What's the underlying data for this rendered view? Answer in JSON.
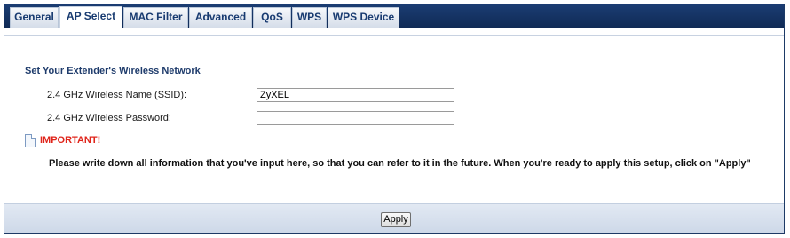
{
  "tabs": [
    {
      "label": "General",
      "active": false
    },
    {
      "label": "AP Select",
      "active": true
    },
    {
      "label": "MAC Filter",
      "active": false
    },
    {
      "label": "Advanced",
      "active": false
    },
    {
      "label": "QoS",
      "active": false
    },
    {
      "label": "WPS",
      "active": false
    },
    {
      "label": "WPS Device",
      "active": false
    }
  ],
  "section": {
    "title": "Set Your Extender's Wireless Network"
  },
  "fields": {
    "ssid": {
      "label": "2.4 GHz Wireless Name (SSID):",
      "value": "ZyXEL"
    },
    "password": {
      "label": "2.4 GHz Wireless Password:",
      "value": ""
    }
  },
  "important": {
    "icon": "document-icon",
    "label": "IMPORTANT!",
    "note": "Please write down all information that you've input here, so that you can refer to it in the future. When you're ready to apply this setup, click on \"Apply\""
  },
  "footer": {
    "apply_label": "Apply"
  },
  "colors": {
    "tabbar": "#1b3d73",
    "tab_text": "#173a70",
    "section_title": "#1f3c6c",
    "important": "#e0251b",
    "footer": "#d8e1ee"
  }
}
